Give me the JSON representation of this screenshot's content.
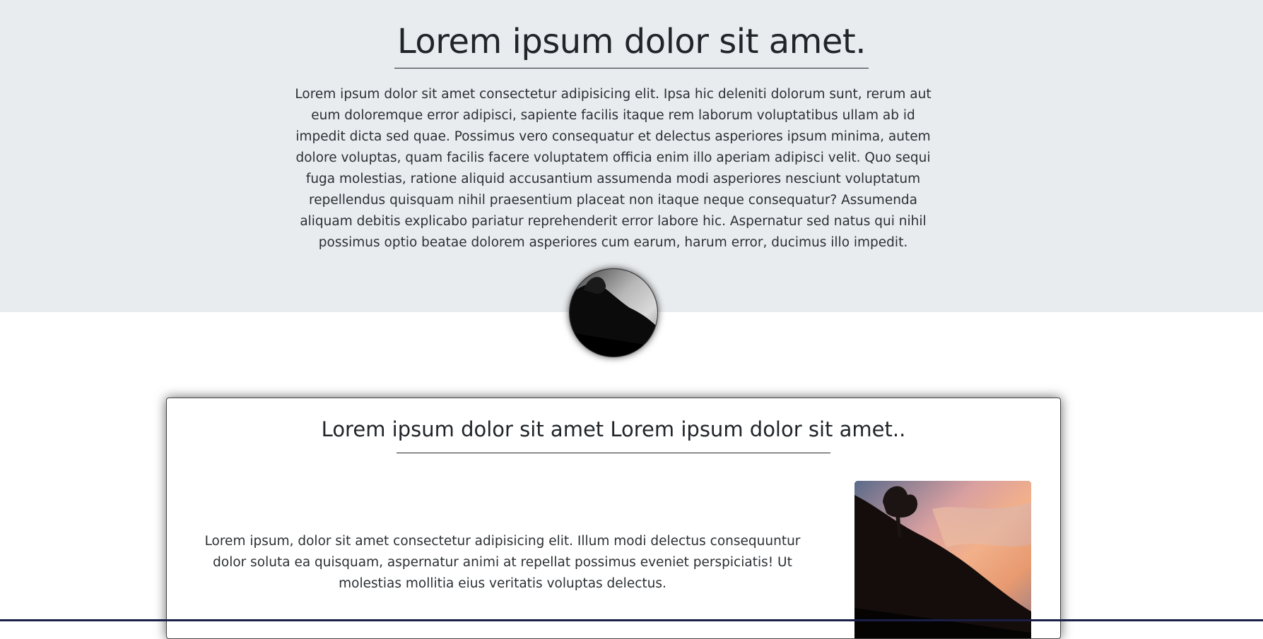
{
  "hero": {
    "title": "Lorem ipsum dolor sit amet.",
    "text": "Lorem ipsum dolor sit amet consectetur adipisicing elit. Ipsa hic deleniti dolorum sunt, rerum aut eum doloremque error adipisci, sapiente facilis itaque rem laborum voluptatibus ullam ab id impedit dicta sed quae. Possimus vero consequatur et delectus asperiores ipsum minima, autem dolore voluptas, quam facilis facere voluptatem officia enim illo aperiam adipisci velit. Quo sequi fuga molestias, ratione aliquid accusantium assumenda modi asperiores nesciunt voluptatum repellendus quisquam nihil praesentium placeat non itaque neque consequatur? Assumenda aliquam debitis explicabo pariatur reprehenderit error labore hic. Aspernatur sed natus qui nihil possimus optio beatae dolorem asperiores cum earum, harum error, ducimus illo impedit.",
    "background_color": "#e9ecef"
  },
  "card": {
    "title": "Lorem ipsum dolor sit amet Lorem ipsum dolor sit amet..",
    "text": "Lorem ipsum, dolor sit amet consectetur adipisicing elit. Illum modi delectus consequuntur dolor soluta ea quisquam, aspernatur animi at repellat possimus eveniet perspiciatis! Ut molestias mollitia eius veritatis voluptas delectus."
  },
  "colors": {
    "text": "#212529",
    "page_background": "#ffffff",
    "bottom_bar": "#1a1f4a"
  }
}
